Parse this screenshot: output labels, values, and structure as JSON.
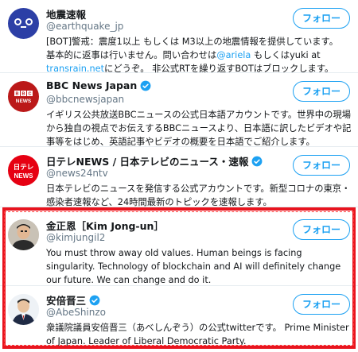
{
  "follow_label": "フォロー",
  "accounts": [
    {
      "name": "地震速報",
      "handle": "@earthquake_jp",
      "verified": false,
      "avatar_icon": "face-emoticon-icon",
      "bio_lines": [
        "[BOT]警戒：震度1以上 もしくは M3以上の地震情報を提供しています。",
        "基本的に返事は行いません。問い合わせは",
        "@ariela",
        " もしくはyuki at",
        "transrain.net",
        "にどうぞ。 非公式RTを繰り返すBOTはブロックします。"
      ]
    },
    {
      "name": "BBC News Japan",
      "handle": "@bbcnewsjapan",
      "verified": true,
      "avatar_text": "BBC NEWS",
      "bio": "イギリス公共放送BBCニュースの公式日本語アカウントです。世界中の現場から独自の視点でお伝えするBBCニュースより、日本語に訳したビデオや記事等をはじめ、英語記事やビデオの概要を日本語でご紹介します。"
    },
    {
      "name": "日テレNEWS / 日本テレビのニュース・速報",
      "handle": "@news24ntv",
      "verified": true,
      "avatar_text_top": "日テレ",
      "avatar_text_bottom": "NEWS",
      "bio": "日本テレビのニュースを発信する公式アカウントです。新型コロナの東京・感染者速報など、24時間最新のトピックを速報します。"
    },
    {
      "name": "金正恩［Kim Jong-un］",
      "handle": "@kimjungil2",
      "verified": false,
      "avatar_icon": "profile-photo-icon",
      "bio": "You must throw away old values. Human beings is facing singularity. Technology of blockchain and AI will definitely change our future. We can change and do it."
    },
    {
      "name": "安倍晋三",
      "handle": "@AbeShinzo",
      "verified": true,
      "avatar_icon": "profile-photo-icon",
      "bio": "衆議院議員安倍晋三（あべしんぞう）の公式twitterです。 Prime Minister of Japan. Leader of Liberal Democratic Party."
    }
  ],
  "colors": {
    "accent": "#1da1f2",
    "highlight": "#e8141e",
    "bbc": "#bb1919",
    "ntv": "#e60012"
  }
}
